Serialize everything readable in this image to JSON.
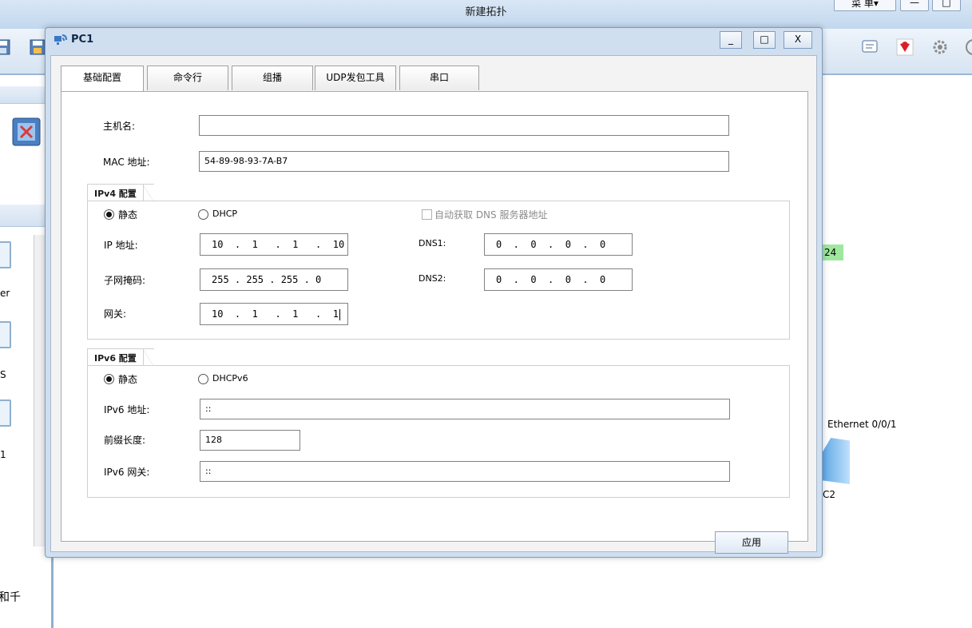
{
  "app": {
    "title": "新建拓扑",
    "menu_label": "菜 单▾",
    "minimize": "—",
    "restore": "□"
  },
  "background": {
    "left_labels": [
      "er",
      "S",
      "1"
    ],
    "bottom_text": "和千",
    "link_label": "24",
    "interface_label": "Ethernet 0/0/1",
    "device_label": "C2"
  },
  "window": {
    "title": "PC1",
    "minimize": "_",
    "maximize": "□",
    "close": "X"
  },
  "tabs": [
    "基础配置",
    "命令行",
    "组播",
    "UDP发包工具",
    "串口"
  ],
  "basic": {
    "hostname_label": "主机名:",
    "hostname_value": "",
    "mac_label": "MAC 地址:",
    "mac_value": "54-89-98-93-7A-B7"
  },
  "ipv4": {
    "group_title": "IPv4 配置",
    "static_label": "静态",
    "dhcp_label": "DHCP",
    "auto_dns_label": "自动获取 DNS 服务器地址",
    "ip_label": "IP 地址:",
    "ip_value": "10  .  1   .  1   .  10",
    "mask_label": "子网掩码:",
    "mask_value": "255 . 255 . 255 . 0",
    "gateway_label": "网关:",
    "gateway_value": "10  .  1   .  1   .  1",
    "dns1_label": "DNS1:",
    "dns1_value": "0  .  0  .  0  .  0",
    "dns2_label": "DNS2:",
    "dns2_value": "0  .  0  .  0  .  0"
  },
  "ipv6": {
    "group_title": "IPv6 配置",
    "static_label": "静态",
    "dhcp_label": "DHCPv6",
    "addr_label": "IPv6 地址:",
    "addr_value": "::",
    "prefix_label": "前缀长度:",
    "prefix_value": "128",
    "gateway_label": "IPv6 网关:",
    "gateway_value": "::"
  },
  "apply_label": "应用"
}
